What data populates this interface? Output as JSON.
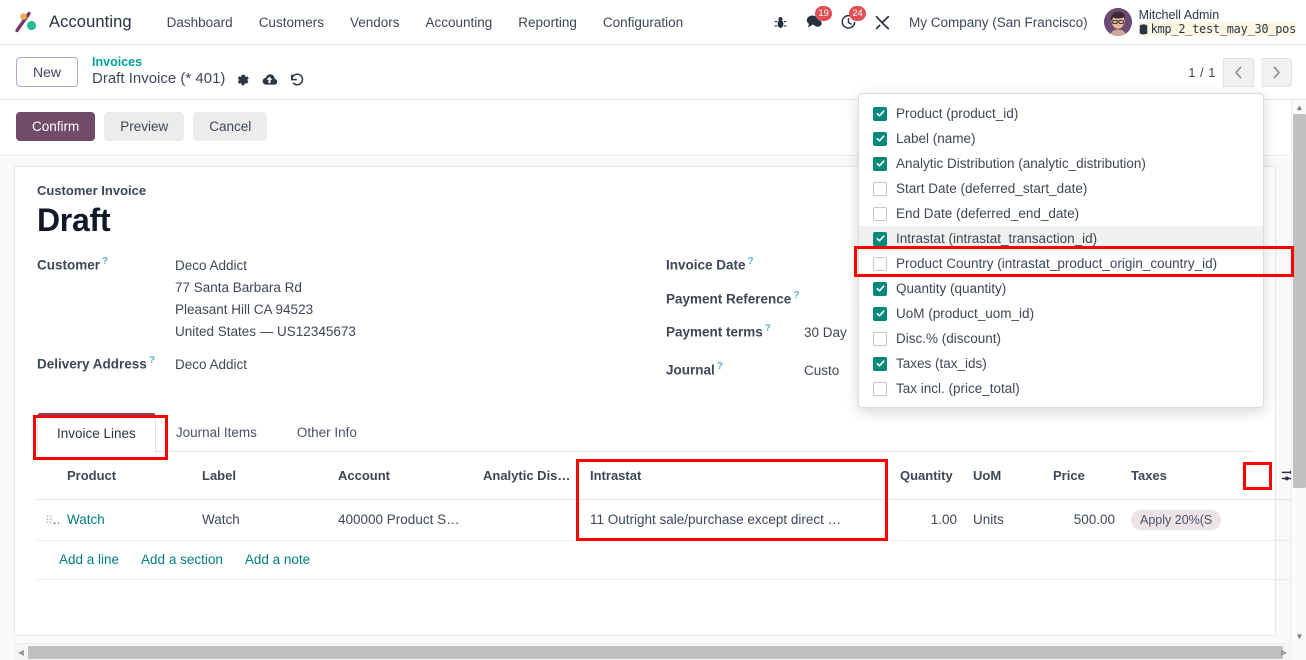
{
  "navbar": {
    "brand": "Accounting",
    "menu_items": [
      {
        "label": "Dashboard"
      },
      {
        "label": "Customers"
      },
      {
        "label": "Vendors"
      },
      {
        "label": "Accounting"
      },
      {
        "label": "Reporting"
      },
      {
        "label": "Configuration"
      }
    ],
    "debug_icon": "bug-icon",
    "messages": {
      "icon": "chat-icon",
      "badge": "19"
    },
    "activities": {
      "icon": "clock-icon",
      "badge": "24"
    },
    "tools_icon": "wrench-icon",
    "company": "My Company (San Francisco)",
    "user_name": "Mitchell Admin",
    "user_database": "kmp_2_test_may_30_pos"
  },
  "control_panel": {
    "new_label": "New",
    "breadcrumb_parent": "Invoices",
    "breadcrumb_current": "Draft Invoice (* 401)",
    "gear_icon": "gear-icon",
    "save_icon": "cloud-upload-icon",
    "discard_icon": "discard-icon",
    "pager_value": "1 / 1",
    "prev_icon": "chevron-left-icon",
    "next_icon": "chevron-right-icon"
  },
  "statusbar": {
    "confirm_label": "Confirm",
    "preview_label": "Preview",
    "cancel_label": "Cancel"
  },
  "form": {
    "doc_type": "Customer Invoice",
    "state_title": "Draft",
    "left_fields": [
      {
        "label": "Customer",
        "value_lines": [
          "Deco Addict",
          "77 Santa Barbara Rd",
          "Pleasant Hill CA 94523",
          "United States — US12345673"
        ]
      },
      {
        "label": "Delivery Address",
        "value_lines": [
          "Deco Addict"
        ]
      }
    ],
    "right_fields": [
      {
        "label": "Invoice Date",
        "value": ""
      },
      {
        "label": "Payment Reference",
        "value": ""
      },
      {
        "label": "Payment terms",
        "value": "30 Day"
      },
      {
        "label": "Journal",
        "value": "Custo"
      }
    ]
  },
  "notebook": {
    "tabs": [
      {
        "label": "Invoice Lines",
        "active": true
      },
      {
        "label": "Journal Items",
        "active": false
      },
      {
        "label": "Other Info",
        "active": false
      }
    ]
  },
  "lines_table": {
    "columns": [
      {
        "label": "Product",
        "align": "left"
      },
      {
        "label": "Label",
        "align": "left"
      },
      {
        "label": "Account",
        "align": "left"
      },
      {
        "label": "Analytic Dis…",
        "align": "left"
      },
      {
        "label": "Intrastat",
        "align": "left"
      },
      {
        "label": "Quantity",
        "align": "right"
      },
      {
        "label": "UoM",
        "align": "left"
      },
      {
        "label": "Price",
        "align": "right"
      },
      {
        "label": "Taxes",
        "align": "left"
      }
    ],
    "optional_columns_icon": "sliders-icon",
    "rows": [
      {
        "product": "Watch",
        "label": "Watch",
        "account": "400000 Product S…",
        "analytic": "",
        "intrastat": "11 Outright sale/purchase except direct …",
        "quantity": "1.00",
        "uom": "Units",
        "price": "500.00",
        "tax": "Apply 20%(S"
      }
    ],
    "add_line": "Add a line",
    "add_section": "Add a section",
    "add_note": "Add a note"
  },
  "optional_columns_dropdown": {
    "items": [
      {
        "label": "Product (product_id)",
        "checked": true,
        "highlighted": false
      },
      {
        "label": "Label (name)",
        "checked": true,
        "highlighted": false
      },
      {
        "label": "Analytic Distribution (analytic_distribution)",
        "checked": true,
        "highlighted": false
      },
      {
        "label": "Start Date (deferred_start_date)",
        "checked": false,
        "highlighted": false
      },
      {
        "label": "End Date (deferred_end_date)",
        "checked": false,
        "highlighted": false
      },
      {
        "label": "Intrastat (intrastat_transaction_id)",
        "checked": true,
        "highlighted": true
      },
      {
        "label": "Product Country (intrastat_product_origin_country_id)",
        "checked": false,
        "highlighted": false
      },
      {
        "label": "Quantity (quantity)",
        "checked": true,
        "highlighted": false
      },
      {
        "label": "UoM (product_uom_id)",
        "checked": true,
        "highlighted": false
      },
      {
        "label": "Disc.% (discount)",
        "checked": false,
        "highlighted": false
      },
      {
        "label": "Taxes (tax_ids)",
        "checked": true,
        "highlighted": false
      },
      {
        "label": "Tax incl. (price_total)",
        "checked": false,
        "highlighted": false
      }
    ]
  },
  "colors": {
    "primary": "#714b67",
    "accent_teal": "#017e84",
    "checkbox_on": "#00897b",
    "badge_red": "#e04f53",
    "annotation": "#ff0000"
  }
}
